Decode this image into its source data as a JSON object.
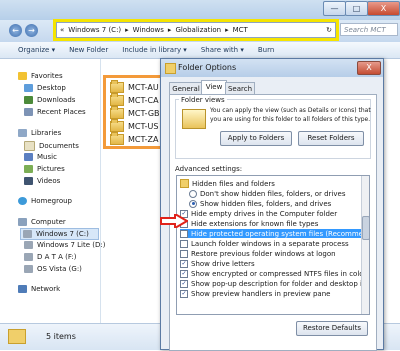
{
  "window": {
    "controls": {
      "minimize": "—",
      "maximize": "□",
      "close": "X"
    },
    "nav": {
      "back": "←",
      "forward": "→"
    },
    "address": {
      "chevron": "«",
      "parts": [
        "Windows 7 (C:)",
        "Windows",
        "Globalization",
        "MCT"
      ],
      "separator": "▸",
      "refresh": "↻"
    },
    "search_placeholder": "Search MCT"
  },
  "toolbar": {
    "organize": "Organize ▾",
    "new_folder": "New Folder",
    "include": "Include in library ▾",
    "share": "Share with ▾",
    "burn": "Burn"
  },
  "nav_pane": {
    "favorites": "Favorites",
    "desktop": "Desktop",
    "downloads": "Downloads",
    "recent": "Recent Places",
    "libraries": "Libraries",
    "documents": "Documents",
    "music": "Music",
    "pictures": "Pictures",
    "videos": "Videos",
    "homegroup": "Homegroup",
    "computer": "Computer",
    "drives": [
      "Windows 7 (C:)",
      "Windows 7 Lite (D:)",
      "D A T A (F:)",
      "OS Vista (G:)"
    ],
    "network": "Network"
  },
  "folders": [
    "MCT-AU",
    "MCT-CA",
    "MCT-GB",
    "MCT-US",
    "MCT-ZA"
  ],
  "status": {
    "count": "5 items"
  },
  "dialog": {
    "title": "Folder Options",
    "close": "X",
    "tabs": [
      "General",
      "View",
      "Search"
    ],
    "folder_views_label": "Folder views",
    "folder_views_text1": "You can apply the view (such as Details or Icons) that",
    "folder_views_text2": "you are using for this folder to all folders of this type.",
    "apply_button": "Apply to Folders",
    "reset_button": "Reset Folders",
    "advanced_label": "Advanced settings:",
    "settings": [
      {
        "kind": "folder",
        "label": "Hidden files and folders"
      },
      {
        "kind": "radio",
        "checked": false,
        "label": "Don't show hidden files, folders, or drives"
      },
      {
        "kind": "radio",
        "checked": true,
        "label": "Show hidden files, folders, and drives"
      },
      {
        "kind": "check",
        "checked": true,
        "label": "Hide empty drives in the Computer folder"
      },
      {
        "kind": "check",
        "checked": false,
        "label": "Hide extensions for known file types"
      },
      {
        "kind": "check",
        "checked": false,
        "label": "Hide protected operating system files (Recommended)",
        "highlighted": true
      },
      {
        "kind": "check",
        "checked": false,
        "label": "Launch folder windows in a separate process"
      },
      {
        "kind": "check",
        "checked": false,
        "label": "Restore previous folder windows at logon"
      },
      {
        "kind": "check",
        "checked": true,
        "label": "Show drive letters"
      },
      {
        "kind": "check",
        "checked": true,
        "label": "Show encrypted or compressed NTFS files in color"
      },
      {
        "kind": "check",
        "checked": true,
        "label": "Show pop-up description for folder and desktop items"
      },
      {
        "kind": "check",
        "checked": true,
        "label": "Show preview handlers in preview pane"
      }
    ],
    "restore_button": "Restore Defaults",
    "check_mark": "✓"
  },
  "colors": {
    "highlight_box": "#f5e400",
    "folder_box": "#f39a3a",
    "arrow": "#e0231b",
    "selection": "#3399ff"
  }
}
